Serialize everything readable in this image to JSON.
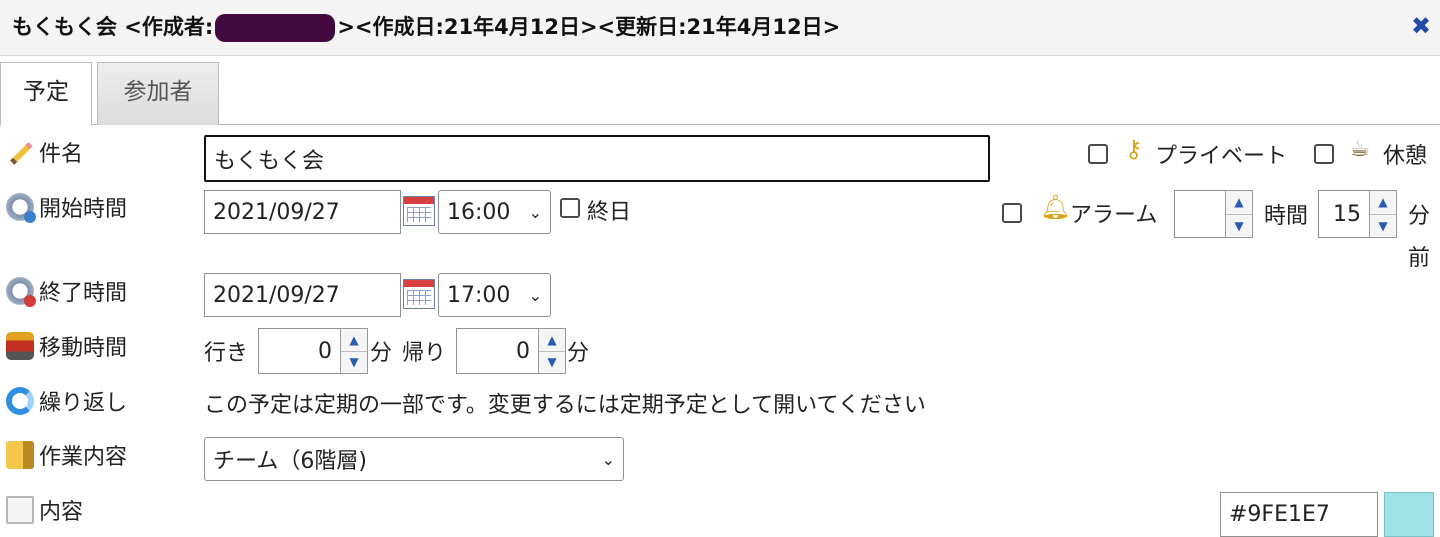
{
  "title": {
    "prefix": "もくもく会 <作成者:",
    "suffix": "><作成日:21年4月12日><更新日:21年4月12日>",
    "close_icon": "close-icon"
  },
  "tabs": [
    {
      "label": "予定",
      "active": true
    },
    {
      "label": "参加者",
      "active": false
    }
  ],
  "form": {
    "subject": {
      "label": "件名",
      "value": "もくもく会",
      "icon": "pencil-icon"
    },
    "private_label": "プライベート",
    "break_label": "休憩",
    "start": {
      "label": "開始時間",
      "date": "2021/09/27",
      "time": "16:00",
      "icon": "clock-start-icon"
    },
    "allday_label": "終日",
    "alarm": {
      "label": "アラーム",
      "value": "",
      "unit_hours": "時間",
      "minutes": "15",
      "unit_minutes": "分",
      "suffix": "前"
    },
    "end": {
      "label": "終了時間",
      "date": "2021/09/27",
      "time": "17:00",
      "icon": "clock-end-icon"
    },
    "travel": {
      "label": "移動時間",
      "go_label": "行き",
      "go_value": "0",
      "return_label": "帰り",
      "return_value": "0",
      "unit": "分",
      "icon": "train-icon"
    },
    "repeat": {
      "label": "繰り返し",
      "message": "この予定は定期の一部です。変更するには定期予定として開いてください",
      "icon": "repeat-icon"
    },
    "task": {
      "label": "作業内容",
      "value": "チーム（6階層)",
      "icon": "book-icon"
    },
    "content": {
      "label": "内容",
      "icon": "document-icon"
    },
    "color": {
      "hex": "#9FE1E7",
      "swatch": "#9fe1e7"
    }
  }
}
